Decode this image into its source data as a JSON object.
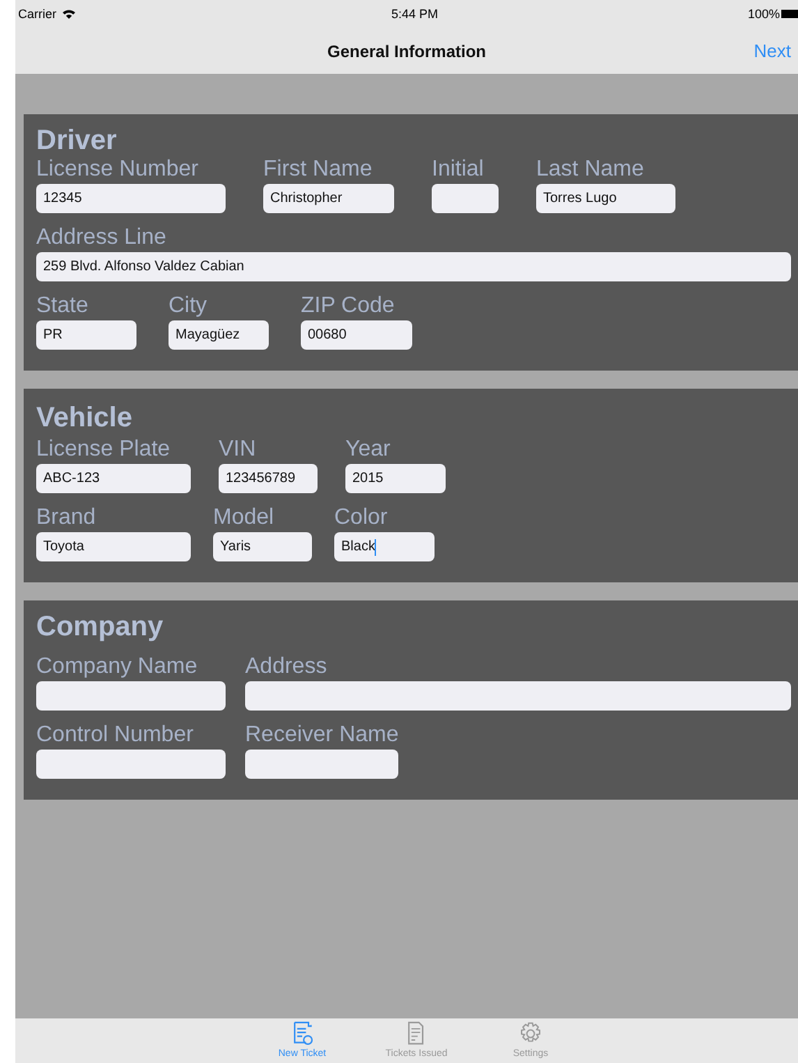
{
  "status_bar": {
    "carrier": "Carrier",
    "time": "5:44 PM",
    "battery": "100%"
  },
  "nav_bar": {
    "title": "General Information",
    "action": "Next"
  },
  "sections": [
    {
      "title": "Driver",
      "rows": [
        {
          "fields": [
            {
              "label": "License Number",
              "value": "12345",
              "focused": false
            },
            {
              "label": "First Name",
              "value": "Christopher",
              "focused": false
            },
            {
              "label": "Initial",
              "focused": false
            },
            {
              "label": "Last Name",
              "value": "Torres Lugo",
              "focused": false
            }
          ]
        },
        {
          "fields": [
            {
              "label": "Address Line",
              "value": "259 Blvd. Alfonso Valdez Cabian",
              "focused": false
            }
          ]
        },
        {
          "fields": [
            {
              "label": "State",
              "value": "PR",
              "focused": false
            },
            {
              "label": "City",
              "value": "Mayagüez",
              "focused": false
            },
            {
              "label": "ZIP Code",
              "value": "00680",
              "focused": false
            }
          ]
        }
      ]
    },
    {
      "title": "Vehicle",
      "rows": [
        {
          "fields": [
            {
              "label": "License Plate",
              "value": "ABC-123",
              "focused": false
            },
            {
              "label": "VIN",
              "value": "123456789",
              "focused": false
            },
            {
              "label": "Year",
              "value": "2015",
              "focused": false
            }
          ]
        },
        {
          "fields": [
            {
              "label": "Brand",
              "value": "Toyota",
              "focused": false
            },
            {
              "label": "Model",
              "value": "Yaris",
              "focused": false
            },
            {
              "label": "Color",
              "value": "Black",
              "focused": true
            }
          ]
        }
      ]
    },
    {
      "title": "Company",
      "rows": [
        {
          "fields": [
            {
              "label": "Company Name",
              "focused": false
            },
            {
              "label": "Address",
              "focused": false
            }
          ]
        },
        {
          "fields": [
            {
              "label": "Control Number",
              "focused": false
            },
            {
              "label": "Receiver Name",
              "focused": false
            }
          ]
        }
      ]
    }
  ],
  "tab_bar": [
    {
      "label": "New Ticket",
      "kind": "ticket",
      "selected": true
    },
    {
      "label": "Tickets Issued",
      "kind": "document",
      "selected": false
    },
    {
      "label": "Settings",
      "kind": "gear",
      "selected": false
    }
  ]
}
